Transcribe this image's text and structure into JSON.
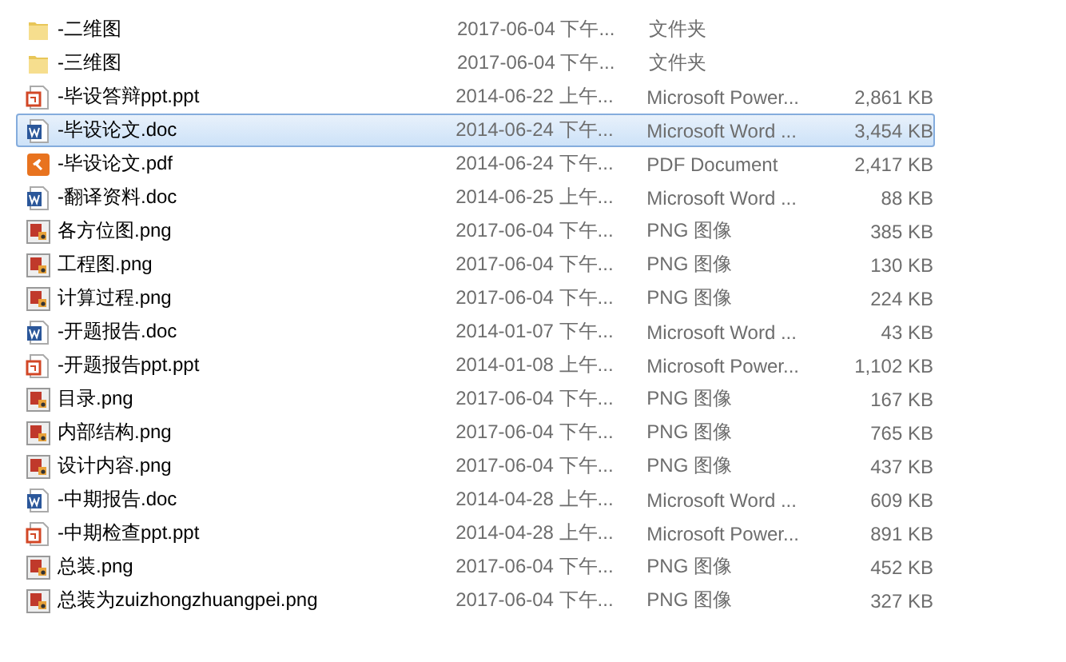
{
  "files": [
    {
      "kind": "folder",
      "name": "-二维图",
      "date": "2017-06-04 下午...",
      "type": "文件夹",
      "selected": false
    },
    {
      "kind": "folder",
      "name": "-三维图",
      "date": "2017-06-04 下午...",
      "type": "文件夹",
      "selected": false
    },
    {
      "kind": "ppt",
      "name": "-毕设答辩ppt.ppt",
      "date": "2014-06-22 上午...",
      "type": "Microsoft Power...",
      "size": "2,861 KB",
      "selected": false
    },
    {
      "kind": "word",
      "name": "-毕设论文.doc",
      "date": "2014-06-24 下午...",
      "type": "Microsoft Word ...",
      "size": "3,454 KB",
      "selected": true
    },
    {
      "kind": "pdf",
      "name": "-毕设论文.pdf",
      "date": "2014-06-24 下午...",
      "type": "PDF Document",
      "size": "2,417 KB",
      "selected": false
    },
    {
      "kind": "word",
      "name": "-翻译资料.doc",
      "date": "2014-06-25 上午...",
      "type": "Microsoft Word ...",
      "size": "88 KB",
      "selected": false
    },
    {
      "kind": "image",
      "name": "各方位图.png",
      "date": "2017-06-04 下午...",
      "type": "PNG 图像",
      "size": "385 KB",
      "selected": false
    },
    {
      "kind": "image",
      "name": "工程图.png",
      "date": "2017-06-04 下午...",
      "type": "PNG 图像",
      "size": "130 KB",
      "selected": false
    },
    {
      "kind": "image",
      "name": "计算过程.png",
      "date": "2017-06-04 下午...",
      "type": "PNG 图像",
      "size": "224 KB",
      "selected": false
    },
    {
      "kind": "word",
      "name": "-开题报告.doc",
      "date": "2014-01-07 下午...",
      "type": "Microsoft Word ...",
      "size": "43 KB",
      "selected": false
    },
    {
      "kind": "ppt",
      "name": "-开题报告ppt.ppt",
      "date": "2014-01-08 上午...",
      "type": "Microsoft Power...",
      "size": "1,102 KB",
      "selected": false
    },
    {
      "kind": "image",
      "name": "目录.png",
      "date": "2017-06-04 下午...",
      "type": "PNG 图像",
      "size": "167 KB",
      "selected": false
    },
    {
      "kind": "image",
      "name": "内部结构.png",
      "date": "2017-06-04 下午...",
      "type": "PNG 图像",
      "size": "765 KB",
      "selected": false
    },
    {
      "kind": "image",
      "name": "设计内容.png",
      "date": "2017-06-04 下午...",
      "type": "PNG 图像",
      "size": "437 KB",
      "selected": false
    },
    {
      "kind": "word",
      "name": "-中期报告.doc",
      "date": "2014-04-28 上午...",
      "type": "Microsoft Word ...",
      "size": "609 KB",
      "selected": false
    },
    {
      "kind": "ppt",
      "name": "-中期检查ppt.ppt",
      "date": "2014-04-28 上午...",
      "type": "Microsoft Power...",
      "size": "891 KB",
      "selected": false
    },
    {
      "kind": "image",
      "name": "总装.png",
      "date": "2017-06-04 下午...",
      "type": "PNG 图像",
      "size": "452 KB",
      "selected": false
    },
    {
      "kind": "image",
      "name": "总装为zuizhongzhuangpei.png",
      "date": "2017-06-04 下午...",
      "type": "PNG 图像",
      "size": "327 KB",
      "selected": false
    }
  ]
}
